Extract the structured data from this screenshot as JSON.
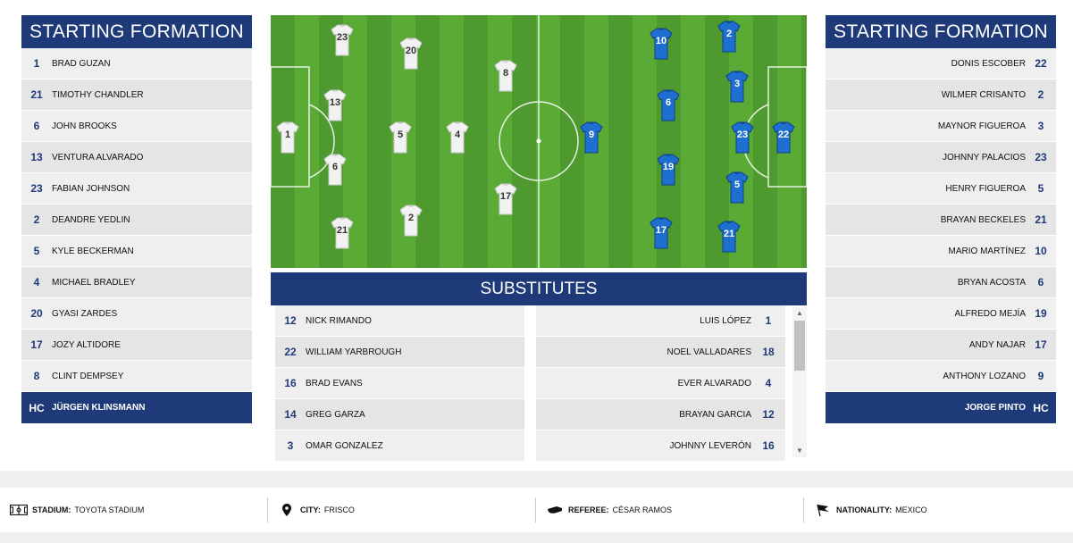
{
  "home": {
    "header": "STARTING FORMATION",
    "players": [
      {
        "num": "1",
        "name": "BRAD GUZAN"
      },
      {
        "num": "21",
        "name": "TIMOTHY CHANDLER"
      },
      {
        "num": "6",
        "name": "JOHN BROOKS"
      },
      {
        "num": "13",
        "name": "VENTURA ALVARADO"
      },
      {
        "num": "23",
        "name": "FABIAN JOHNSON"
      },
      {
        "num": "2",
        "name": "DEANDRE YEDLIN"
      },
      {
        "num": "5",
        "name": "KYLE BECKERMAN"
      },
      {
        "num": "4",
        "name": "MICHAEL BRADLEY"
      },
      {
        "num": "20",
        "name": "GYASI ZARDES"
      },
      {
        "num": "17",
        "name": "JOZY ALTIDORE"
      },
      {
        "num": "8",
        "name": "CLINT DEMPSEY"
      }
    ],
    "coach_label": "HC",
    "coach": "JÜRGEN KLINSMANN",
    "subs": [
      {
        "num": "12",
        "name": "NICK RIMANDO"
      },
      {
        "num": "22",
        "name": "WILLIAM YARBROUGH"
      },
      {
        "num": "16",
        "name": "BRAD EVANS"
      },
      {
        "num": "14",
        "name": "GREG GARZA"
      },
      {
        "num": "3",
        "name": "OMAR GONZALEZ"
      }
    ]
  },
  "away": {
    "header": "STARTING FORMATION",
    "players": [
      {
        "num": "22",
        "name": "DONIS ESCOBER"
      },
      {
        "num": "2",
        "name": "WILMER CRISANTO"
      },
      {
        "num": "3",
        "name": "MAYNOR FIGUEROA"
      },
      {
        "num": "23",
        "name": "JOHNNY PALACIOS"
      },
      {
        "num": "5",
        "name": "HENRY FIGUEROA"
      },
      {
        "num": "21",
        "name": "BRAYAN BECKELES"
      },
      {
        "num": "10",
        "name": "MARIO MARTÍNEZ"
      },
      {
        "num": "6",
        "name": "BRYAN ACOSTA"
      },
      {
        "num": "19",
        "name": "ALFREDO MEJÍA"
      },
      {
        "num": "17",
        "name": "ANDY NAJAR"
      },
      {
        "num": "9",
        "name": "ANTHONY LOZANO"
      }
    ],
    "coach_label": "HC",
    "coach": "JORGE PINTO",
    "subs": [
      {
        "num": "1",
        "name": "LUIS LÓPEZ"
      },
      {
        "num": "18",
        "name": "NOEL VALLADARES"
      },
      {
        "num": "4",
        "name": "EVER ALVARADO"
      },
      {
        "num": "12",
        "name": "BRAYAN GARCIA"
      },
      {
        "num": "16",
        "name": "JOHNNY LEVERÓN"
      }
    ]
  },
  "pitch": {
    "home_kit_color": "#f2f2f2",
    "away_kit_color": "#1f6fd1",
    "home_shirts": [
      "23",
      "20",
      "8",
      "13",
      "1",
      "5",
      "4",
      "6",
      "17",
      "21",
      "2"
    ],
    "away_shirts": [
      "10",
      "2",
      "6",
      "3",
      "9",
      "23",
      "22",
      "19",
      "5",
      "17",
      "21"
    ]
  },
  "substitutes_header": "SUBSTITUTES",
  "info": {
    "stadium_label": "STADIUM:",
    "stadium": "TOYOTA STADIUM",
    "city_label": "CITY:",
    "city": "FRISCO",
    "referee_label": "REFEREE:",
    "referee": "CÉSAR RAMOS",
    "nationality_label": "NATIONALITY:",
    "nationality": "MEXICO"
  },
  "colors": {
    "navy": "#1f3a78",
    "grass_dark": "#4e9a2e",
    "grass_light": "#5aab36"
  }
}
